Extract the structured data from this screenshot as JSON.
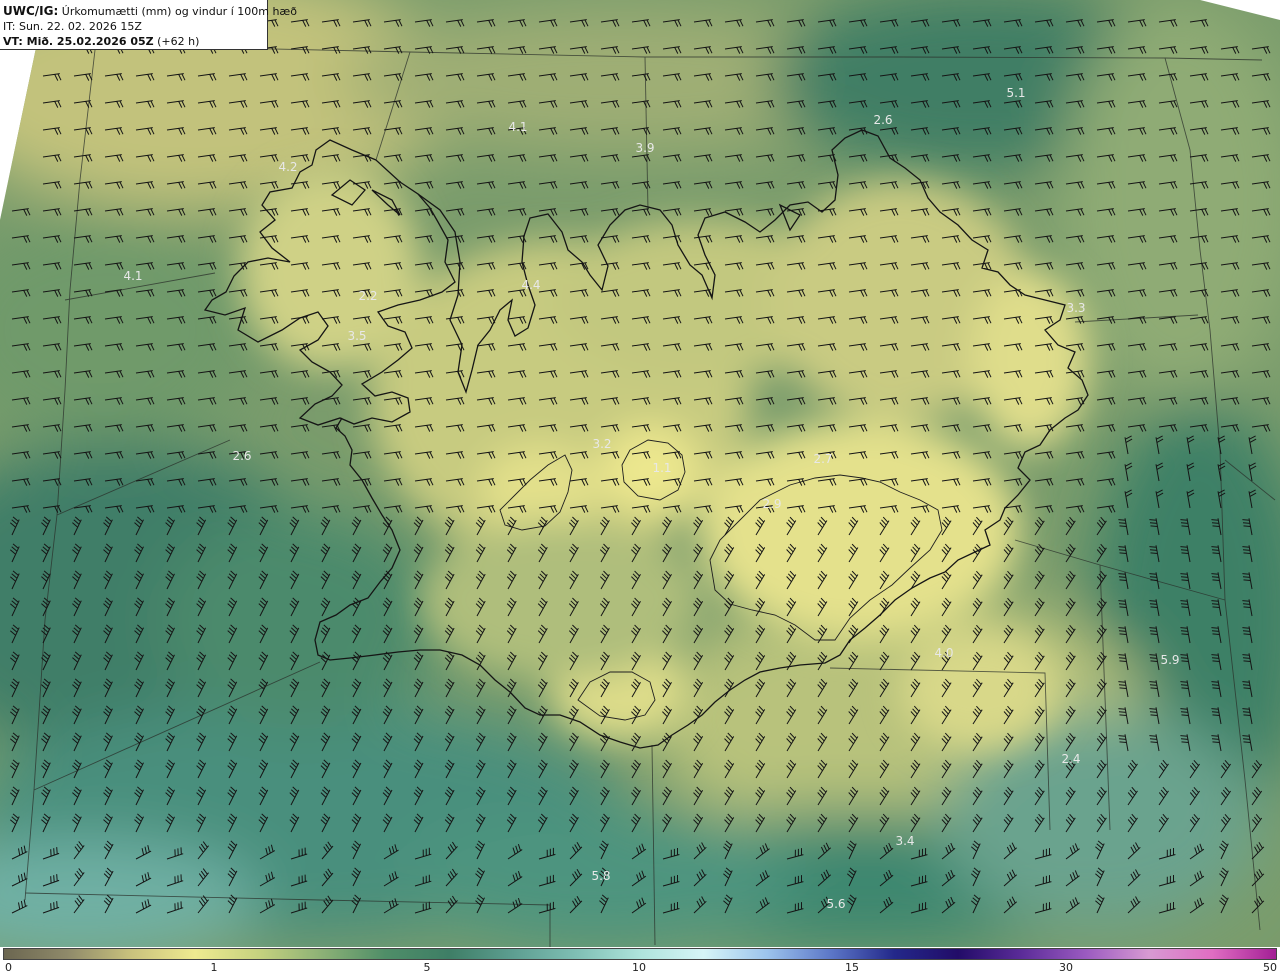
{
  "header": {
    "model": "UWC/IG:",
    "title": "Úrkomumætti (mm) og vindur í 100m hæð",
    "issue_time": "IT: Sun. 22. 02. 2026 15Z",
    "valid_prefix": "VT: Mið. 25.02.2026 05Z",
    "valid_offset": "(+62 h)"
  },
  "colorbar": {
    "ticks": [
      "0",
      "1",
      "5",
      "10",
      "15",
      "30",
      "50"
    ],
    "colors": [
      "#6b6650",
      "#8f8a6a",
      "#c9c27d",
      "#eeea90",
      "#c6d27f",
      "#8cb176",
      "#4f8e68",
      "#3e7e66",
      "#5d9e91",
      "#7fbfb4",
      "#aee3dc",
      "#d6f5f7",
      "#9cc3ec",
      "#5c77c8",
      "#23288a",
      "#220c68",
      "#5b2c99",
      "#9a5ac0",
      "#d79ad3",
      "#e06dc2",
      "#a31f95"
    ]
  },
  "map": {
    "values": [
      "4.1",
      "3.9",
      "2.6",
      "5.1",
      "4.2",
      "4.1",
      "4.4",
      "2.2",
      "3.5",
      "3.3",
      "2.6",
      "3.2",
      "1.1",
      "2.7",
      "2.9",
      "4.0",
      "5.9",
      "2.4",
      "3.4",
      "5.8",
      "5.6"
    ]
  }
}
